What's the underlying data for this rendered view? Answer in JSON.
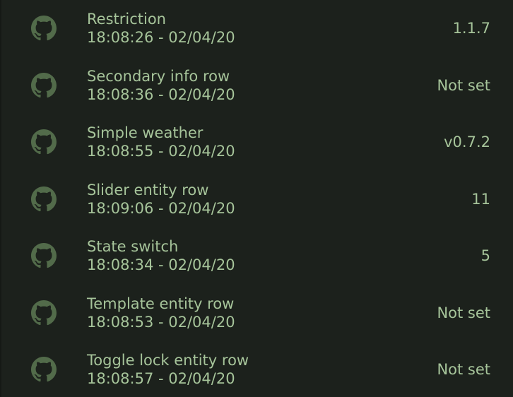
{
  "colors": {
    "background": "#1c211c",
    "text": "#a6c49a",
    "icon": "#526b4a"
  },
  "rows": [
    {
      "icon": "github-icon",
      "title": "Restriction",
      "subtitle": "18:08:26 - 02/04/20",
      "value": "1.1.7"
    },
    {
      "icon": "github-icon",
      "title": "Secondary info row",
      "subtitle": "18:08:36 - 02/04/20",
      "value": "Not set"
    },
    {
      "icon": "github-icon",
      "title": "Simple weather",
      "subtitle": "18:08:55 - 02/04/20",
      "value": "v0.7.2"
    },
    {
      "icon": "github-icon",
      "title": "Slider entity row",
      "subtitle": "18:09:06 - 02/04/20",
      "value": "11"
    },
    {
      "icon": "github-icon",
      "title": "State switch",
      "subtitle": "18:08:34 - 02/04/20",
      "value": "5"
    },
    {
      "icon": "github-icon",
      "title": "Template entity row",
      "subtitle": "18:08:53 - 02/04/20",
      "value": "Not set"
    },
    {
      "icon": "github-icon",
      "title": "Toggle lock entity row",
      "subtitle": "18:08:57 - 02/04/20",
      "value": "Not set"
    }
  ]
}
